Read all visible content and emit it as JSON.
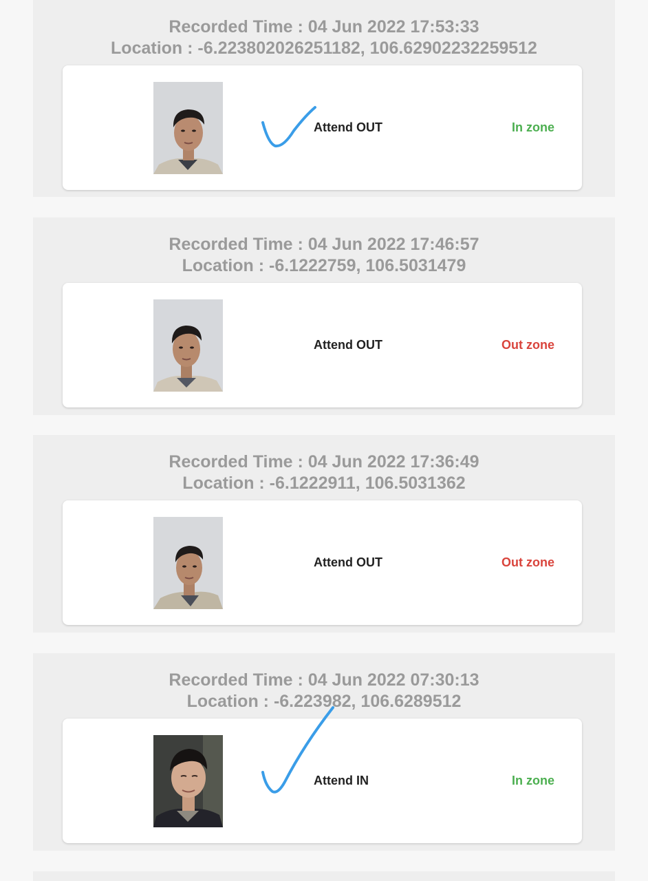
{
  "records": [
    {
      "recorded_time": "Recorded Time : 04 Jun 2022 17:53:33",
      "location": "Location : -6.223802026251182, 106.62902232259512",
      "photo_icon": "person-photo",
      "action": "Attend OUT",
      "zone": "In zone",
      "zone_color": "#4caf50"
    },
    {
      "recorded_time": "Recorded Time : 04 Jun 2022 17:46:57",
      "location": "Location : -6.1222759, 106.5031479",
      "photo_icon": "person-photo",
      "action": "Attend OUT",
      "zone": "Out zone",
      "zone_color": "#d9443c"
    },
    {
      "recorded_time": "Recorded Time : 04 Jun 2022 17:36:49",
      "location": "Location : -6.1222911, 106.5031362",
      "photo_icon": "person-photo",
      "action": "Attend OUT",
      "zone": "Out zone",
      "zone_color": "#d9443c"
    },
    {
      "recorded_time": "Recorded Time : 04 Jun 2022 07:30:13",
      "location": "Location : -6.223982, 106.6289512",
      "photo_icon": "person-photo",
      "action": "Attend IN",
      "zone": "In zone",
      "zone_color": "#4caf50"
    }
  ],
  "annotations": {
    "check_marks": [
      "check-mark-icon",
      "check-mark-icon"
    ],
    "check_color": "#3a9de8"
  },
  "colors": {
    "record_background": "#eeeeee",
    "card_background": "#ffffff",
    "header_text": "#9a9a9a",
    "action_text": "#222222"
  }
}
